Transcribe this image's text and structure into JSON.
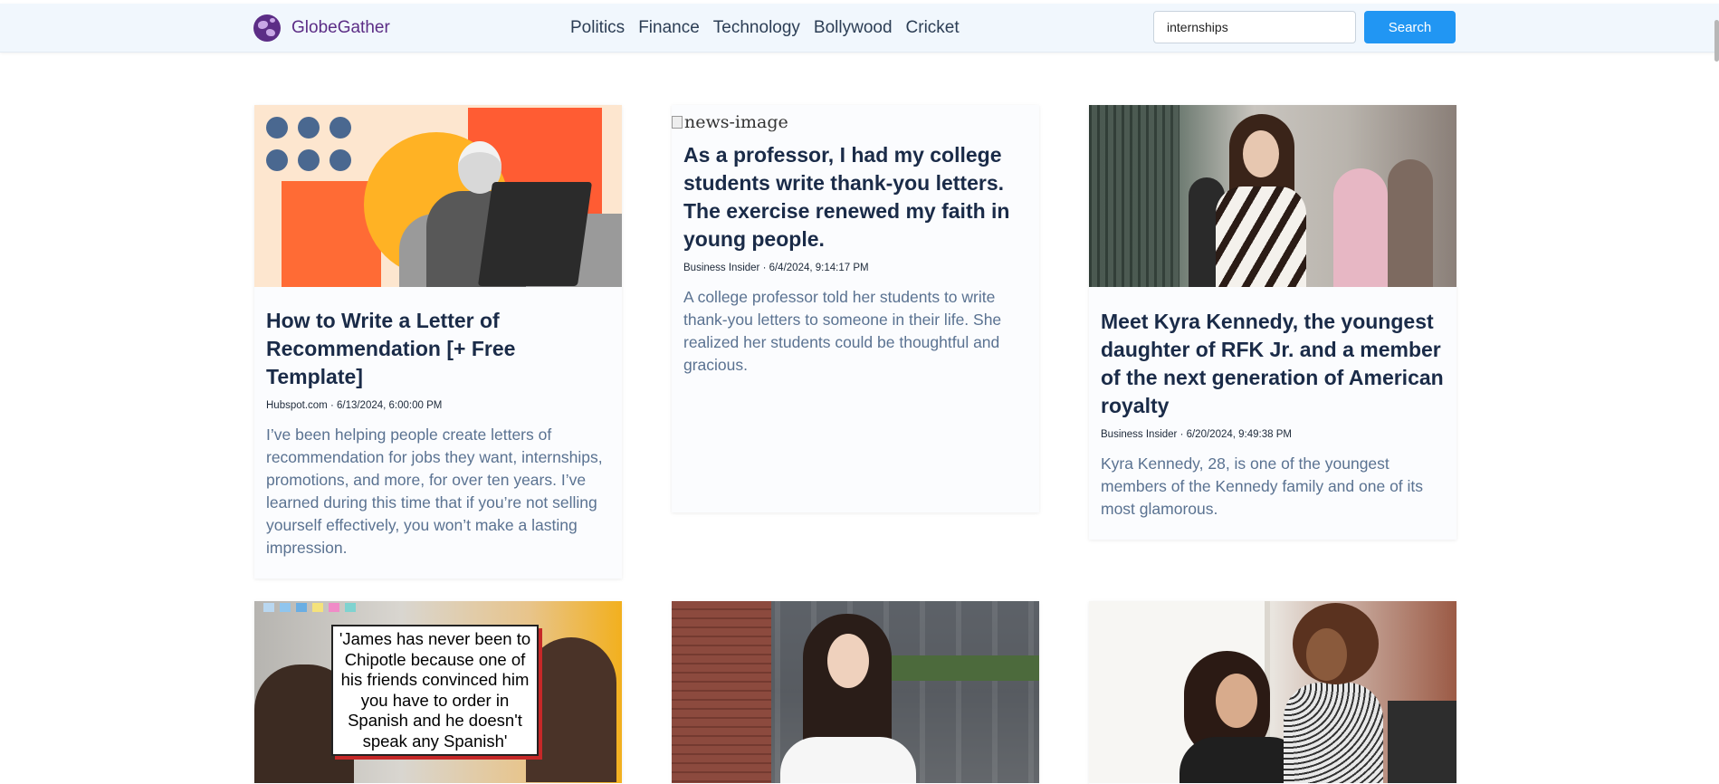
{
  "brand": {
    "name": "GlobeGather"
  },
  "nav": {
    "links": [
      "Politics",
      "Finance",
      "Technology",
      "Bollywood",
      "Cricket"
    ]
  },
  "search": {
    "value": "internships",
    "button_label": "Search"
  },
  "articles": [
    {
      "title": "How to Write a Letter of Recommendation [+ Free Template]",
      "meta": "Hubspot.com · 6/13/2024, 6:00:00 PM",
      "description": "I’ve been helping people create letters of recommendation for jobs they want, internships, promotions, and more, for over ten years. I’ve learned during this time that if you’re not selling yourself effectively, you won’t make a lasting impression."
    },
    {
      "image_alt": "news-image",
      "title": "As a professor, I had my college students write thank-you letters. The exercise renewed my faith in young people.",
      "meta": "Business Insider · 6/4/2024, 9:14:17 PM",
      "description": "A college professor told her students to write thank-you letters to someone in their life. She realized her students could be thoughtful and gracious."
    },
    {
      "title": "Meet Kyra Kennedy, the youngest daughter of RFK Jr. and a member of the next generation of American royalty",
      "meta": "Business Insider · 6/20/2024, 9:49:38 PM",
      "description": "Kyra Kennedy, 28, is one of the youngest members of the Kennedy family and one of its most glamorous."
    },
    {
      "image_caption": "'James has never been to Chipotle because one of his friends convinced him you have to order in Spanish and he doesn't speak any Spanish'"
    },
    {},
    {}
  ]
}
